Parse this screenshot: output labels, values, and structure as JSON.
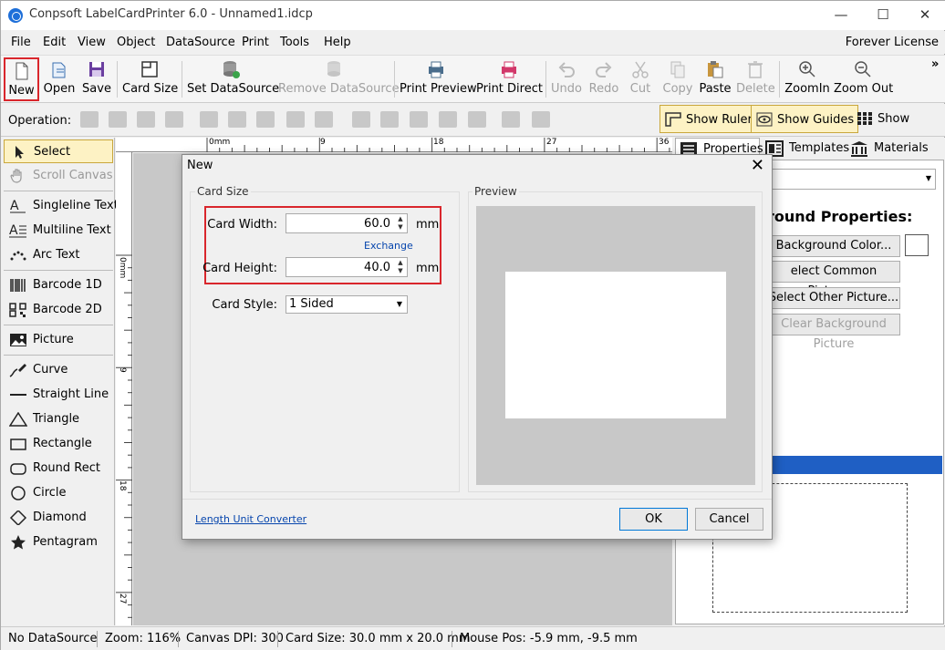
{
  "window": {
    "title": "Conpsoft LabelCardPrinter 6.0 - Unnamed1.idcp",
    "minimize": "—",
    "maximize": "☐",
    "close": "✕"
  },
  "menu": {
    "items": [
      "File",
      "Edit",
      "View",
      "Object",
      "DataSource",
      "Print",
      "Tools",
      "Help"
    ],
    "license": "Forever License"
  },
  "toolbar": {
    "new": "New",
    "open": "Open",
    "save": "Save",
    "card_size": "Card Size",
    "set_datasource": "Set DataSource",
    "remove_datasource": "Remove DataSource",
    "print_preview": "Print Preview",
    "print_direct": "Print Direct",
    "undo": "Undo",
    "redo": "Redo",
    "cut": "Cut",
    "copy": "Copy",
    "paste": "Paste",
    "delete": "Delete",
    "zoom_in": "ZoomIn",
    "zoom_out": "Zoom Out",
    "overflow": "»"
  },
  "operation": {
    "label": "Operation:",
    "show_ruler": "Show Ruler",
    "show_guides": "Show Guides",
    "show_grids": "Show Grids"
  },
  "tools": {
    "select": "Select",
    "scroll_canvas": "Scroll Canvas",
    "singleline_text": "Singleline Text",
    "multiline_text": "Multiline Text",
    "arc_text": "Arc Text",
    "barcode_1d": "Barcode 1D",
    "barcode_2d": "Barcode 2D",
    "picture": "Picture",
    "curve": "Curve",
    "straight_line": "Straight Line",
    "triangle": "Triangle",
    "rectangle": "Rectangle",
    "round_rect": "Round Rect",
    "circle": "Circle",
    "diamond": "Diamond",
    "pentagram": "Pentagram"
  },
  "ruler": {
    "top": [
      "0mm",
      "9",
      "18",
      "27",
      "36"
    ],
    "left": [
      "0mm",
      "9",
      "18",
      "27"
    ]
  },
  "right_panel": {
    "tab_properties": "Properties",
    "tab_templates": "Templates",
    "tab_materials": "Materials",
    "heading": "round Properties:",
    "background_color": "Background Color...",
    "select_common_picture": "elect Common Picture...",
    "select_other_picture": "Select Other Picture...",
    "clear_background_picture": "Clear Background Picture"
  },
  "status": {
    "datasource": "No DataSource",
    "zoom": "Zoom: 116%",
    "dpi": "Canvas DPI: 300",
    "card_size": "Card Size: 30.0 mm x 20.0 mm",
    "mouse_pos": "Mouse Pos: -5.9 mm, -9.5 mm"
  },
  "dialog": {
    "title": "New",
    "close": "✕",
    "group_card_size": "Card Size",
    "group_preview": "Preview",
    "card_width_label": "Card Width:",
    "card_width_value": "60.0",
    "card_height_label": "Card Height:",
    "card_height_value": "40.0",
    "unit": "mm",
    "exchange": "Exchange",
    "card_style_label": "Card Style:",
    "card_style_value": "1 Sided",
    "length_unit_converter": "Length Unit Converter",
    "ok": "OK",
    "cancel": "Cancel"
  },
  "colors": {
    "highlight_red": "#d9262c",
    "toggle_on": "#fdf2c4",
    "blue_bar": "#1f5fc4",
    "link": "#0645ad"
  }
}
